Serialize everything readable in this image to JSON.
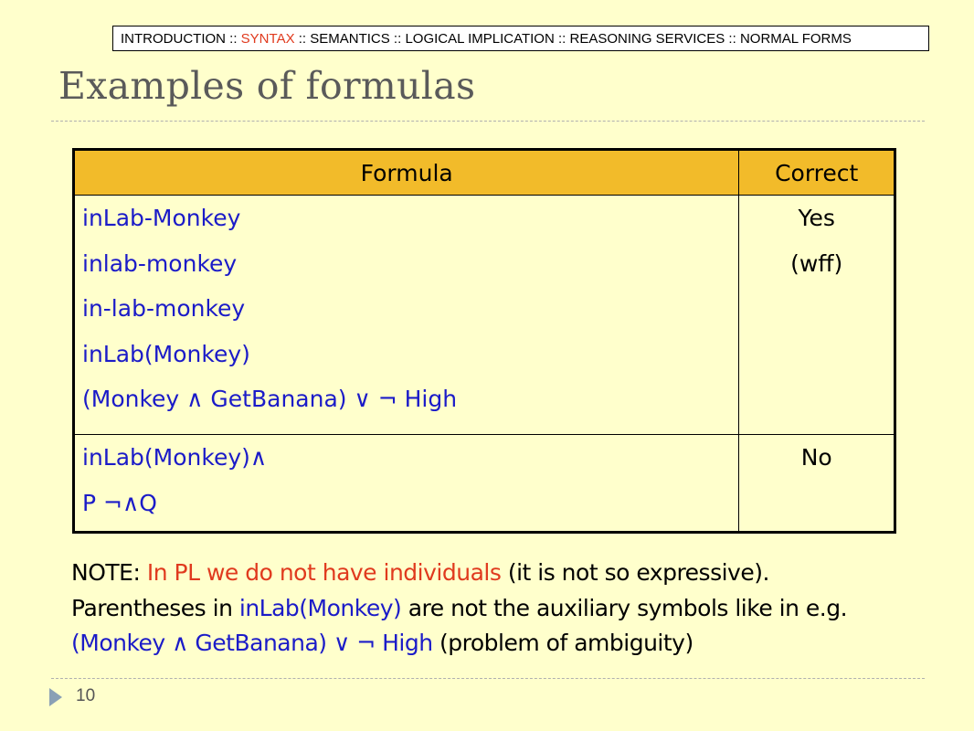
{
  "nav": {
    "items": [
      {
        "label": "INTRODUCTION",
        "active": false
      },
      {
        "label": "SYNTAX",
        "active": true
      },
      {
        "label": "SEMANTICS",
        "active": false
      },
      {
        "label": "LOGICAL IMPLICATION",
        "active": false
      },
      {
        "label": "REASONING SERVICES",
        "active": false
      },
      {
        "label": "NORMAL FORMS",
        "active": false
      }
    ],
    "separator": " :: "
  },
  "title": "Examples of formulas",
  "table": {
    "headers": {
      "formula": "Formula",
      "correct": "Correct"
    },
    "groups": [
      {
        "formulas": [
          "inLab-Monkey",
          "inlab-monkey",
          "in-lab-monkey",
          "inLab(Monkey)",
          "(Monkey ∧ GetBanana) ∨ ¬ High"
        ],
        "correct": [
          "Yes",
          "(wff)"
        ]
      },
      {
        "formulas": [
          "inLab(Monkey)∧",
          "P ¬∧Q"
        ],
        "correct": [
          "No"
        ]
      }
    ]
  },
  "note": {
    "line1": {
      "label": "NOTE:",
      "highlight": "In PL we do not have individuals",
      "rest": "(it is not so expressive)."
    },
    "line2": {
      "before": "Parentheses in",
      "highlight": "inLab(Monkey)",
      "after": "are not the auxiliary symbols like in e.g."
    },
    "line3": {
      "highlight": "(Monkey ∧ GetBanana) ∨ ¬ High",
      "after": "(problem of ambiguity)"
    }
  },
  "page_number": "10",
  "colors": {
    "background": "#ffffcc",
    "header_fill": "#f2bb2a",
    "formula_text": "#1b1bc8",
    "highlight_red": "#e03a1e",
    "title_gray": "#5a5a5a"
  }
}
